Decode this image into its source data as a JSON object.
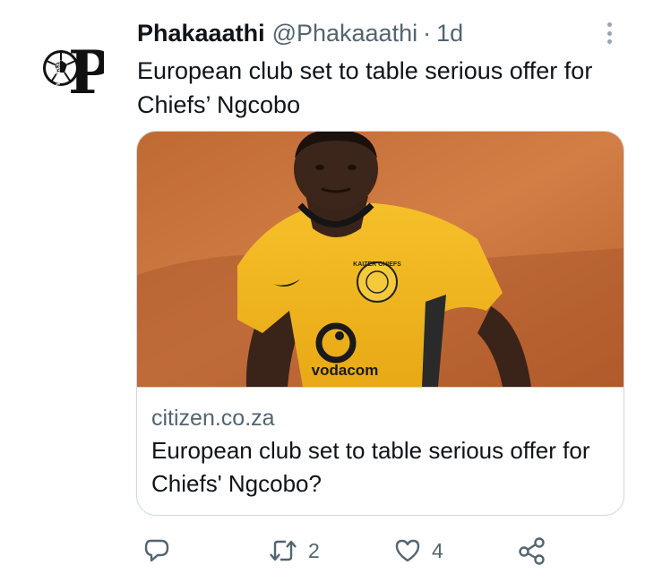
{
  "tweet": {
    "display_name": "Phakaaathi",
    "handle": "@Phakaaathi",
    "separator": "·",
    "time": "1d",
    "text": "European club set to table serious offer for Chiefs’ Ngcobo"
  },
  "avatar": {
    "logo_letter": "P",
    "logo_text": "Phakaaathi"
  },
  "card": {
    "image_icon": "photo-of-footballer",
    "jersey_text": "vodacom",
    "badge_text": "KAIZER CHIEFS",
    "domain": "citizen.co.za",
    "title": "European club set to table serious offer for Chiefs' Ngcobo?"
  },
  "actions": {
    "reply_icon": "speech-bubble-icon",
    "retweet_icon": "retweet-arrows-icon",
    "retweet_count": "2",
    "like_icon": "heart-icon",
    "like_count": "4",
    "share_icon": "share-nodes-icon"
  },
  "colors": {
    "text_primary": "#0f1419",
    "text_secondary": "#536471",
    "border": "#cfd9de",
    "jersey_yellow": "#f0b51e",
    "stadium_orange": "#c8703a"
  }
}
